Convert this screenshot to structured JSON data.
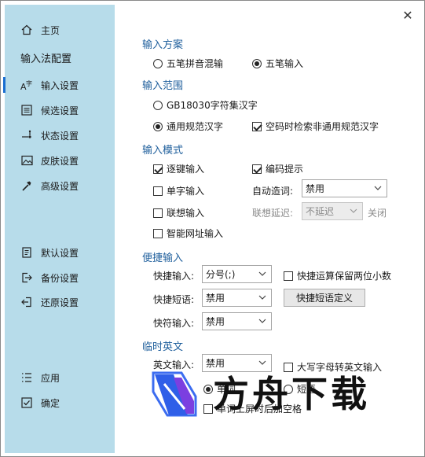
{
  "sidebar": {
    "home_label": "主页",
    "title": "输入法配置",
    "items": [
      {
        "label": "输入设置",
        "icon": "input-setting-icon",
        "active": true
      },
      {
        "label": "候选设置",
        "icon": "candidate-icon"
      },
      {
        "label": "状态设置",
        "icon": "status-icon"
      },
      {
        "label": "皮肤设置",
        "icon": "skin-icon"
      },
      {
        "label": "高级设置",
        "icon": "advanced-icon"
      }
    ],
    "actions": [
      {
        "label": "默认设置",
        "icon": "default-icon"
      },
      {
        "label": "备份设置",
        "icon": "backup-icon"
      },
      {
        "label": "还原设置",
        "icon": "restore-icon"
      }
    ],
    "apply_label": "应用",
    "ok_label": "确定"
  },
  "scheme": {
    "title": "输入方案",
    "opt1": "五笔拼音混输",
    "opt2": "五笔输入"
  },
  "range": {
    "title": "输入范围",
    "opt1": "GB18030字符集汉字",
    "opt2": "通用规范汉字",
    "check1": "空码时检索非通用规范汉字"
  },
  "mode": {
    "title": "输入模式",
    "key_by_key": "逐键输入",
    "code_hint": "编码提示",
    "single_char": "单字输入",
    "auto_phrase_label": "自动造词:",
    "auto_phrase_value": "禁用",
    "association": "联想输入",
    "assoc_delay_label": "联想延迟:",
    "assoc_delay_value": "不延迟",
    "close_label": "关闭",
    "smart_url": "智能网址输入"
  },
  "quick": {
    "title": "便捷输入",
    "quick_input_label": "快捷输入:",
    "quick_input_value": "分号(;)",
    "keep_two_decimals": "快捷运算保留两位小数",
    "quick_phrase_label": "快捷短语:",
    "quick_phrase_value": "禁用",
    "define_button": "快捷短语定义",
    "quick_symbol_label": "快符输入:",
    "quick_symbol_value": "禁用"
  },
  "english": {
    "title": "临时英文",
    "english_input_label": "英文输入:",
    "english_input_value": "禁用",
    "caps_to_english": "大写字母转英文输入",
    "word_label": "单词",
    "phrase_label": "短语",
    "space_hint": "单词上屏时后加空格"
  },
  "watermark": {
    "text": "方舟下载"
  }
}
